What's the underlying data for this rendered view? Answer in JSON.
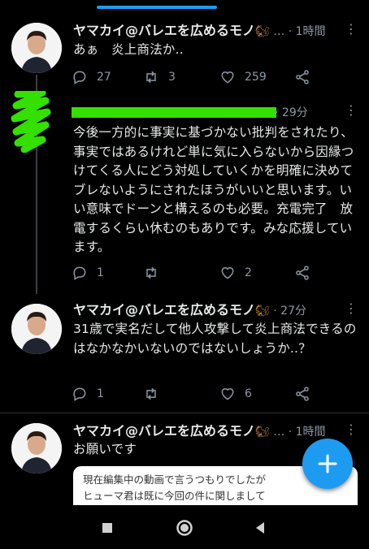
{
  "tweets": [
    {
      "name": "ヤマカイ@バレエを広めるモノ",
      "emoji": "🐿",
      "time": "1時間",
      "text": "あぁ　炎上商法か..",
      "reply_count": "27",
      "retweet_count": "3",
      "like_count": "259"
    },
    {
      "time": "29分",
      "text": "今後一方的に事実に基づかない批判をされたり、事実ではあるけれど単に気に入らないから因縁つけてくる人にどう対処していくかを明確に決めて　ブレないようにされたほうがいいと思います。いい意味でドーンと構えるのも必要。充電完了　放電するくらい休むのもありです。みな応援しています。",
      "reply_count": "1",
      "retweet_count": "",
      "like_count": "2"
    },
    {
      "name": "ヤマカイ@バレエを広めるモノ",
      "emoji": "🐿",
      "time": "27分",
      "text": "31歳で実名だして他人攻撃して炎上商法できるのはなかなかいないのではないしょうか..？",
      "reply_count": "1",
      "retweet_count": "",
      "like_count": "6"
    },
    {
      "name": "ヤマカイ@バレエを広めるモノ",
      "emoji": "🐿",
      "time": "1時間",
      "text": "お願いです",
      "quote_line1": "現在編集中の動画で言うつもりでしたが",
      "quote_line2": "ヒューマ君は既に今回の件に関しまして"
    }
  ],
  "colors": {
    "background": "#000000",
    "accent": "#1d9bf0",
    "secondary_text": "#8b98a5",
    "redaction_green": "#33e000"
  },
  "icons": [
    "reply-icon",
    "retweet-icon",
    "like-icon",
    "share-icon",
    "more-icon",
    "compose-plus-icon",
    "nav-recents-icon",
    "nav-home-icon",
    "nav-back-icon"
  ]
}
